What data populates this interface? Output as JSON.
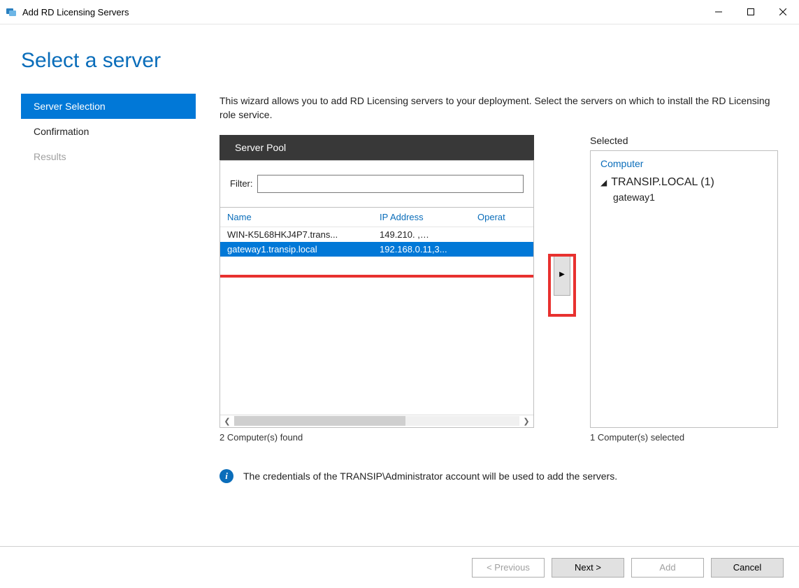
{
  "window": {
    "title": "Add RD Licensing Servers"
  },
  "heading": "Select a server",
  "nav": {
    "items": [
      {
        "label": "Server Selection",
        "state": "active"
      },
      {
        "label": "Confirmation",
        "state": "normal"
      },
      {
        "label": "Results",
        "state": "disabled"
      }
    ]
  },
  "intro": "This wizard allows you to add RD Licensing servers to your deployment. Select the servers on which to install the RD Licensing role service.",
  "pool": {
    "tab_label": "Server Pool",
    "filter_label": "Filter:",
    "filter_value": "",
    "columns": {
      "name": "Name",
      "ip": "IP Address",
      "os": "Operat"
    },
    "rows": [
      {
        "name": "WIN-K5L68HKJ4P7.trans...",
        "ip": "149.210.       ,…",
        "selected": false
      },
      {
        "name": "gateway1.transip.local",
        "ip": "192.168.0.11,3...",
        "selected": true
      }
    ],
    "found_text": "2 Computer(s) found"
  },
  "selected": {
    "title": "Selected",
    "computer_header": "Computer",
    "group_label": "TRANSIP.LOCAL (1)",
    "items": [
      "gateway1"
    ],
    "count_text": "1 Computer(s) selected"
  },
  "info_text": "The credentials of the TRANSIP\\Administrator account will be used to add the servers.",
  "buttons": {
    "previous": "< Previous",
    "next": "Next >",
    "add": "Add",
    "cancel": "Cancel"
  }
}
